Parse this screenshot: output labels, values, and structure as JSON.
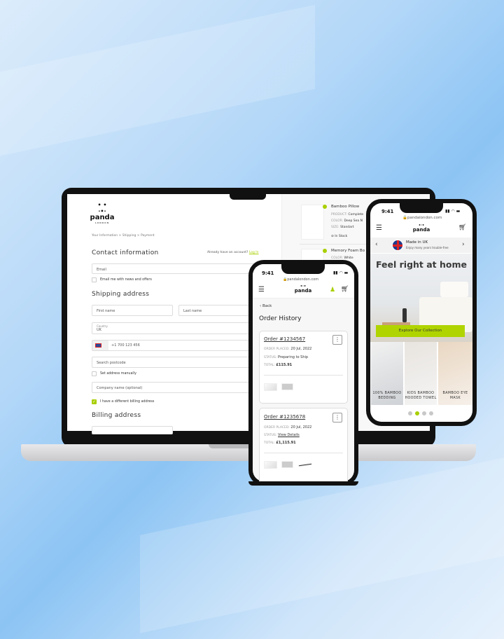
{
  "brand": {
    "name": "panda",
    "sub": "LONDON",
    "accent": "#a8cf00"
  },
  "checkout": {
    "breadcrumb": "Your Information  >  Shipping  >  Payment",
    "contact_title": "Contact information",
    "account_prompt": "Already have an account?",
    "login": "Log In",
    "email_placeholder": "Email",
    "newsletter": "Email me with news and offers",
    "shipping_title": "Shipping address",
    "first_name": "First name",
    "last_name": "Last name",
    "country_label": "Country",
    "country_value": "UK",
    "phone_value": "+1 700 123 456",
    "postcode": "Search postcode",
    "manual": "Set address manually",
    "company": "Company name (optional)",
    "billing_check": "I have a different billing address",
    "billing_title": "Billing address"
  },
  "cart": {
    "items": [
      {
        "name": "Bamboo Pillow",
        "product_label": "PRODUCT:",
        "product": "Complete",
        "color_label": "COLOR:",
        "color": "Deep Sea N",
        "size_label": "SIZE:",
        "size": "Standart",
        "stock": "In Stock"
      },
      {
        "name": "Memory Foam Bo",
        "color_label": "COLOR:",
        "color": "White"
      }
    ]
  },
  "phone1": {
    "time": "9:41",
    "url": "pandalondon.com",
    "back": "Back",
    "title": "Order History",
    "orders": [
      {
        "number": "Order #1234567",
        "placed_label": "ORDER PLACED:",
        "placed": "20 Jul, 2022",
        "status_label": "STATUS:",
        "status": "Preparing to Ship",
        "total_label": "TOTAL:",
        "total": "£115.91"
      },
      {
        "number": "Order #1235678",
        "placed_label": "ORDER PLACED:",
        "placed": "20 Jul, 2022",
        "status_label": "STATUS:",
        "status": "View Details",
        "total_label": "TOTAL:",
        "total": "£1,115.91"
      }
    ]
  },
  "phone2": {
    "time": "9:41",
    "url": "pandalondon.com",
    "banner_title": "Made in UK",
    "banner_sub": "Enjoy many years trouble-free",
    "hero_title": "Feel right at home",
    "cta": "Explore Our Collection",
    "tiles": [
      "100% BAMBOO BEDDING",
      "KIDS BAMBOO HOODED TOWEL",
      "BAMBOO EYE MASK"
    ],
    "carousel": {
      "count": 4,
      "active": 2
    }
  }
}
